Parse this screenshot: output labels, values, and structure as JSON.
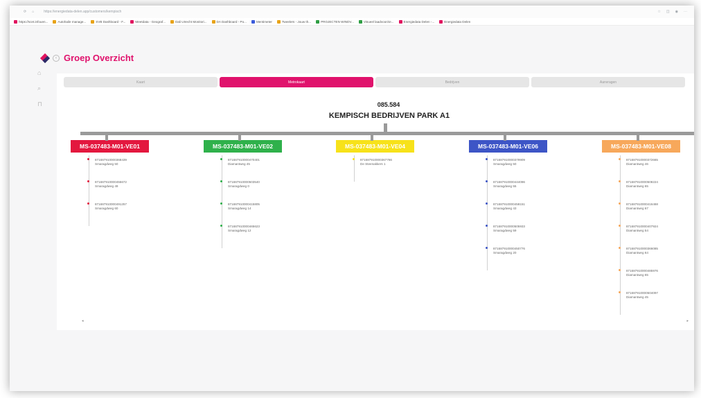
{
  "browser": {
    "url": "https://energiedata-delen.app/customers/kempisch",
    "bookmarks": [
      {
        "label": "https://scet.infouen...",
        "color": "#e0125f"
      },
      {
        "label": "Autohaile manage...",
        "color": "#e8a317"
      },
      {
        "label": "SVB Dashboard - F...",
        "color": "#e8a317"
      },
      {
        "label": "Meetdata - Geograf...",
        "color": "#e0125f"
      },
      {
        "label": "Dali Utrecht Monitori...",
        "color": "#e8a317"
      },
      {
        "label": "DA Dashboard - Po...",
        "color": "#e8a317"
      },
      {
        "label": "Mentimeter",
        "color": "#3b5bdb"
      },
      {
        "label": "Tweelers - Jouw th...",
        "color": "#e8a317"
      },
      {
        "label": "PROJECTEN WINDV...",
        "color": "#2f9e44"
      },
      {
        "label": "Visueel laadvoorzie...",
        "color": "#2f9e44"
      },
      {
        "label": "Energiedata Delen -...",
        "color": "#e0125f"
      },
      {
        "label": "Energiedata Delen",
        "color": "#e0125f"
      }
    ]
  },
  "header": {
    "title": "Groep Overzicht",
    "back_icon": "chevron-left-icon"
  },
  "tabs": [
    {
      "label": "Kaart",
      "active": false
    },
    {
      "label": "Metrokaart",
      "active": true
    },
    {
      "label": "Bedrijven",
      "active": false
    },
    {
      "label": "Aanvragen",
      "active": false
    }
  ],
  "site": {
    "code": "085.584",
    "name": "KEMPISCH BEDRIJVEN PARK A1"
  },
  "groups": [
    {
      "label": "MS-037483-M01-VE01",
      "color": "#e3173e",
      "meters": [
        {
          "ean": "871687910000368439",
          "address": "Smaragdweg 50"
        },
        {
          "ean": "871687910000455672",
          "address": "Smaragdweg 49"
        },
        {
          "ean": "871687910000491257",
          "address": "Smaragdweg 60"
        }
      ]
    },
    {
      "label": "MS-037483-M01-VE02",
      "color": "#2fb14b",
      "meters": [
        {
          "ean": "871687910000470401",
          "address": "Diamantweg 45"
        },
        {
          "ean": "871687910000503540",
          "address": "Smaragdweg 0"
        },
        {
          "ean": "871687910000415805",
          "address": "Smaragdweg 14"
        },
        {
          "ean": "871687910000465623",
          "address": "Smaragdweg 12"
        }
      ]
    },
    {
      "label": "MS-037483-M01-VE04",
      "color": "#f7e21a",
      "meters": [
        {
          "ean": "871687910000367766",
          "address": "De Steenakkers 1"
        }
      ]
    },
    {
      "label": "MS-037483-M01-VE06",
      "color": "#3d55c6",
      "meters": [
        {
          "ean": "871687910000379909",
          "address": "Smaragdweg 50"
        },
        {
          "ean": "871687910000444096",
          "address": "Smaragdweg 55"
        },
        {
          "ean": "871687910000458151",
          "address": "Smaragdweg 43"
        },
        {
          "ean": "871687910000505933",
          "address": "Smaragdweg 59"
        },
        {
          "ean": "871687910000450776",
          "address": "Smaragdweg 20"
        }
      ]
    },
    {
      "label": "MS-037483-M01-VE08",
      "color": "#f7a85b",
      "meters": [
        {
          "ean": "871687910000372665",
          "address": "Diamantweg 46"
        },
        {
          "ean": "871687910000508224",
          "address": "Diamantweg 65"
        },
        {
          "ean": "871687910000416468",
          "address": "Diamantweg 67"
        },
        {
          "ean": "871687910000407924",
          "address": "Diamantweg 54"
        },
        {
          "ean": "871687910000366085",
          "address": "Diamantweg 64"
        },
        {
          "ean": "871687910000485976",
          "address": "Diamantweg 65"
        },
        {
          "ean": "871687910000504097",
          "address": "Diamantweg 45"
        }
      ]
    }
  ],
  "scroll": {
    "left_icon": "arrow-left-icon",
    "right_icon": "arrow-right-icon"
  }
}
